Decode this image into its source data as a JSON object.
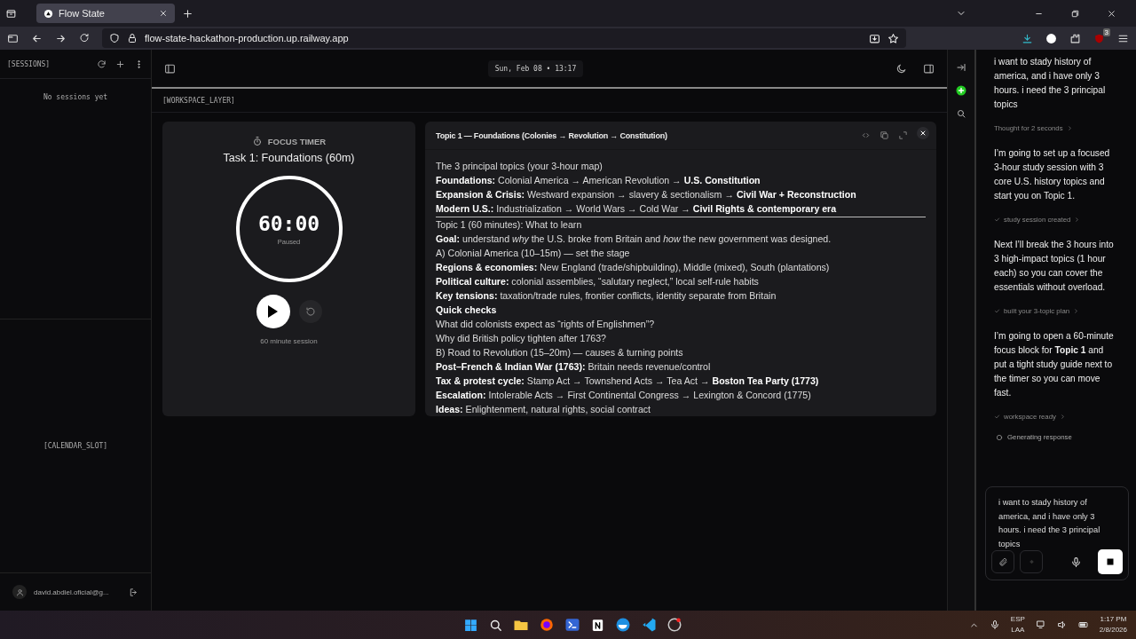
{
  "browser": {
    "tab": {
      "title": "Flow State"
    },
    "url": "flow-state-hackathon-production.up.railway.app",
    "extension_badge": "3"
  },
  "sidebar": {
    "title": "[SESSIONS]",
    "empty_text": "No sessions yet",
    "calendar_label": "[CALENDAR_SLOT]",
    "user_email": "david.abdiel.oficial@g..."
  },
  "header": {
    "datetime": "Sun, Feb 08 • 13:17"
  },
  "workspace": {
    "label": "[WORKSPACE_LAYER]"
  },
  "timer": {
    "heading": "FOCUS TIMER",
    "task": "Task 1: Foundations (60m)",
    "time": "60:00",
    "status": "Paused",
    "caption": "60 minute session"
  },
  "document": {
    "title": "Topic 1 — Foundations (Colonies → Revolution → Constitution)",
    "summary_lines": [
      "The 3 principal topics (your 3-hour map)",
      "**Foundations:** Colonial America → American Revolution → **U.S. Constitution**",
      "**Expansion & Crisis:** Westward expansion → slavery & sectionalism → **Civil War + Reconstruction**",
      "**Modern U.S.:** Industrialization → World Wars → Cold War → **Civil Rights & contemporary era**"
    ],
    "lines": [
      "Topic 1 (60 minutes): What to learn",
      "**Goal:** understand *why* the U.S. broke from Britain and *how* the new government was designed.",
      "A) Colonial America (10–15m) — set the stage",
      "**Regions & economies:** New England (trade/shipbuilding), Middle (mixed), South (plantations)",
      "**Political culture:** colonial assemblies, “salutary neglect,” local self-rule habits",
      "**Key tensions:** taxation/trade rules, frontier conflicts, identity separate from Britain",
      "**Quick checks**",
      "What did colonists expect as “rights of Englishmen”?",
      "Why did British policy tighten after 1763?",
      "B) Road to Revolution (15–20m) — causes & turning points",
      "**Post–French & Indian War (1763):** Britain needs revenue/control",
      "**Tax & protest cycle:** Stamp Act → Townshend Acts → Tea Act → **Boston Tea Party (1773)**",
      "**Escalation:** Intolerable Acts → First Continental Congress → Lexington & Concord (1775)",
      "**Ideas:** Enlightenment, natural rights, social contract"
    ]
  },
  "chat": {
    "messages": [
      {
        "kind": "user",
        "text": "i want to stady history of america, and i have only 3 hours. i need the 3 principal topics"
      },
      {
        "kind": "thought",
        "text": "Thought for 2 seconds"
      },
      {
        "kind": "reply",
        "text": "I’m going to set up a focused 3-hour study session with 3 core U.S. history topics and start you on Topic 1."
      },
      {
        "kind": "step",
        "text": "study session created"
      },
      {
        "kind": "reply",
        "text": "Next I’ll break the 3 hours into 3 high-impact topics (1 hour each) so you can cover the essentials without overload."
      },
      {
        "kind": "step",
        "text": "built your 3-topic plan"
      },
      {
        "kind": "reply",
        "text": "I’m going to open a 60-minute focus block for **Topic 1** and put a tight study guide next to the timer so you can move fast."
      },
      {
        "kind": "step",
        "text": "workspace ready"
      },
      {
        "kind": "loading",
        "text": "Generating response"
      }
    ],
    "input": {
      "value": "i want to stady history of america, and i have only 3 hours. i need the 3 principal topics"
    }
  },
  "taskbar": {
    "language": "ESP",
    "layout": "LAA",
    "time": "1:17 PM",
    "date": "2/8/2026"
  }
}
